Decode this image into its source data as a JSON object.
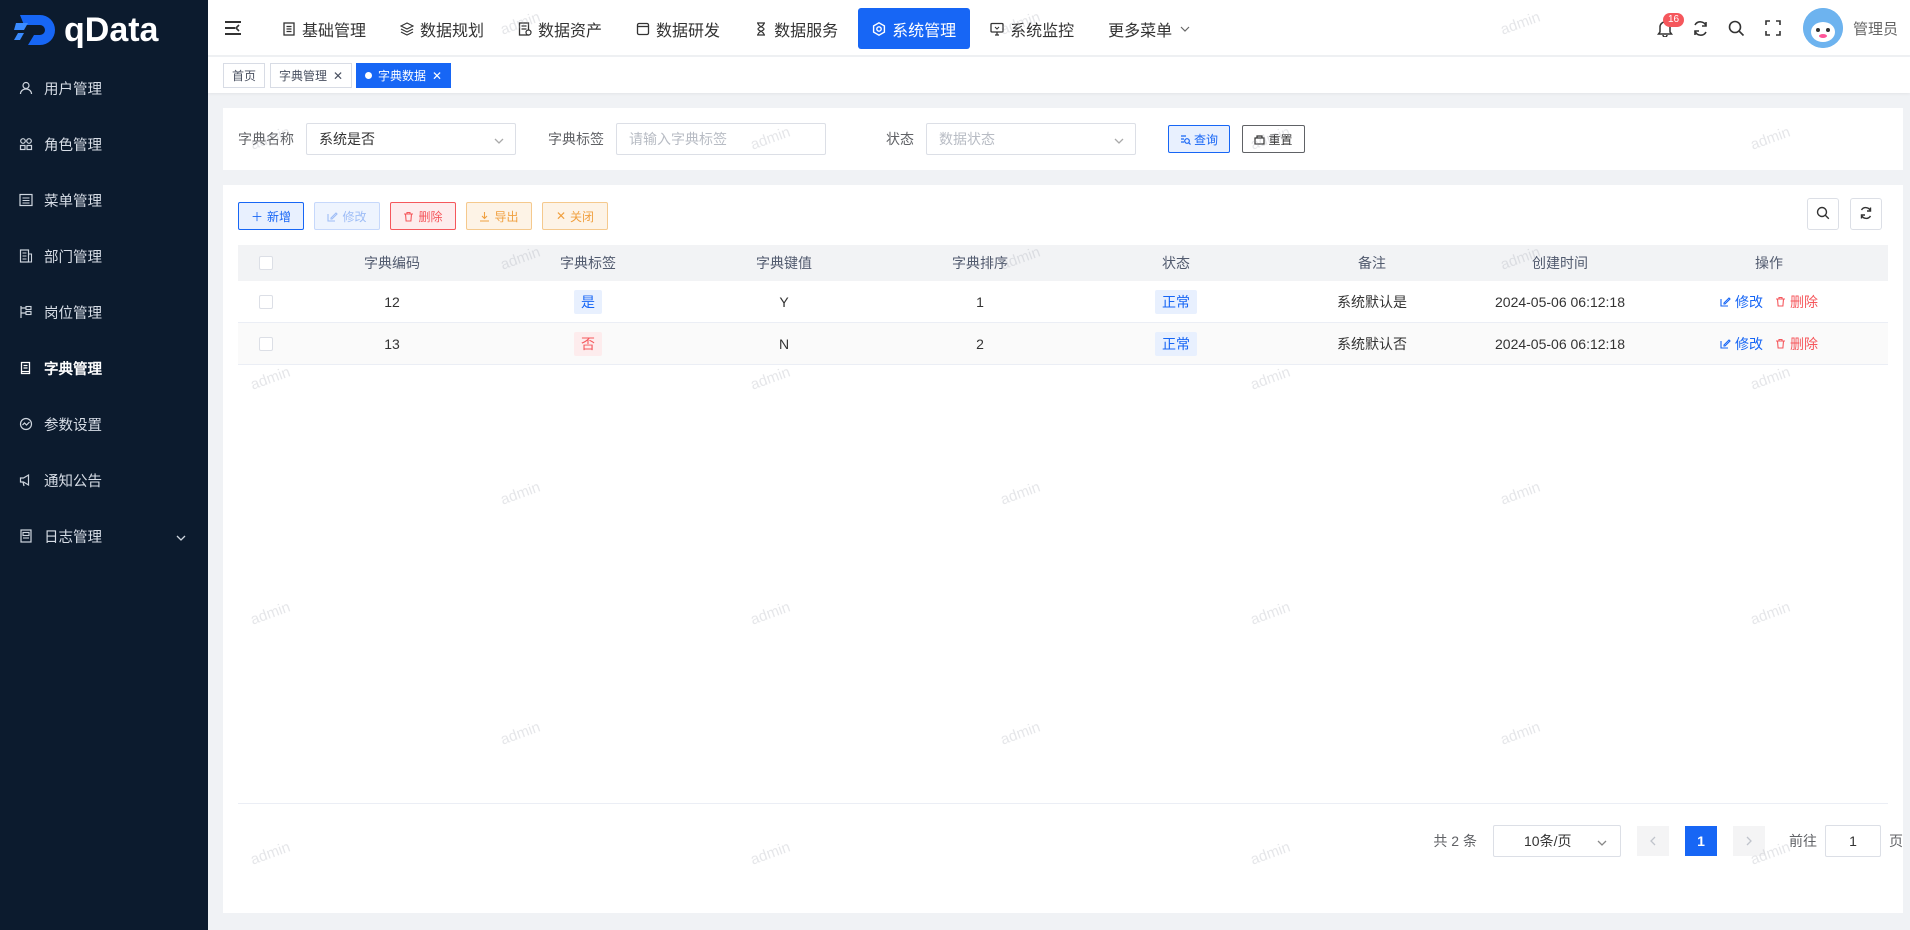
{
  "app": {
    "logo_text": "qData"
  },
  "sidebar": {
    "items": [
      {
        "label": "用户管理",
        "icon": "user-icon"
      },
      {
        "label": "角色管理",
        "icon": "role-icon"
      },
      {
        "label": "菜单管理",
        "icon": "menu-icon"
      },
      {
        "label": "部门管理",
        "icon": "department-icon"
      },
      {
        "label": "岗位管理",
        "icon": "post-icon"
      },
      {
        "label": "字典管理",
        "icon": "dictionary-icon",
        "active": true
      },
      {
        "label": "参数设置",
        "icon": "settings-icon"
      },
      {
        "label": "通知公告",
        "icon": "notice-icon"
      },
      {
        "label": "日志管理",
        "icon": "log-icon",
        "has_children": true
      }
    ]
  },
  "topnav": {
    "items": [
      {
        "label": "基础管理",
        "icon": "basic-icon"
      },
      {
        "label": "数据规划",
        "icon": "layers-icon"
      },
      {
        "label": "数据资产",
        "icon": "asset-icon"
      },
      {
        "label": "数据研发",
        "icon": "dev-icon"
      },
      {
        "label": "数据服务",
        "icon": "hourglass-icon"
      },
      {
        "label": "系统管理",
        "icon": "system-icon",
        "active": true
      },
      {
        "label": "系统监控",
        "icon": "monitor-icon"
      },
      {
        "label": "更多菜单",
        "icon": "",
        "dropdown": true
      }
    ],
    "notification_count": "16",
    "username": "管理员"
  },
  "tags": [
    {
      "label": "首页"
    },
    {
      "label": "字典管理",
      "closable": true
    },
    {
      "label": "字典数据",
      "closable": true,
      "active": true
    }
  ],
  "search": {
    "dict_name_label": "字典名称",
    "dict_name_value": "系统是否",
    "dict_label_label": "字典标签",
    "dict_label_placeholder": "请输入字典标签",
    "status_label": "状态",
    "status_placeholder": "数据状态",
    "query_button": "查询",
    "reset_button": "重置"
  },
  "toolbar": {
    "add": "新增",
    "edit": "修改",
    "delete": "删除",
    "export": "导出",
    "close": "关闭"
  },
  "table": {
    "headers": [
      "字典编码",
      "字典标签",
      "字典键值",
      "字典排序",
      "状态",
      "备注",
      "创建时间",
      "操作"
    ],
    "rows": [
      {
        "code": "12",
        "label": "是",
        "label_color": "blue",
        "value": "Y",
        "sort": "1",
        "status": "正常",
        "remark": "系统默认是",
        "created": "2024-05-06 06:12:18"
      },
      {
        "code": "13",
        "label": "否",
        "label_color": "red",
        "value": "N",
        "sort": "2",
        "status": "正常",
        "remark": "系统默认否",
        "created": "2024-05-06 06:12:18"
      }
    ],
    "row_edit": "修改",
    "row_delete": "删除"
  },
  "pagination": {
    "total_text": "共 2 条",
    "page_size": "10条/页",
    "current_page": "1",
    "goto_label": "前往",
    "goto_value": "1",
    "page_suffix": "页"
  },
  "watermark": "admin",
  "colors": {
    "primary": "#1766f5",
    "danger": "#f5575c",
    "warning": "#f0a040",
    "sidebar_bg": "#0c1b2e"
  }
}
